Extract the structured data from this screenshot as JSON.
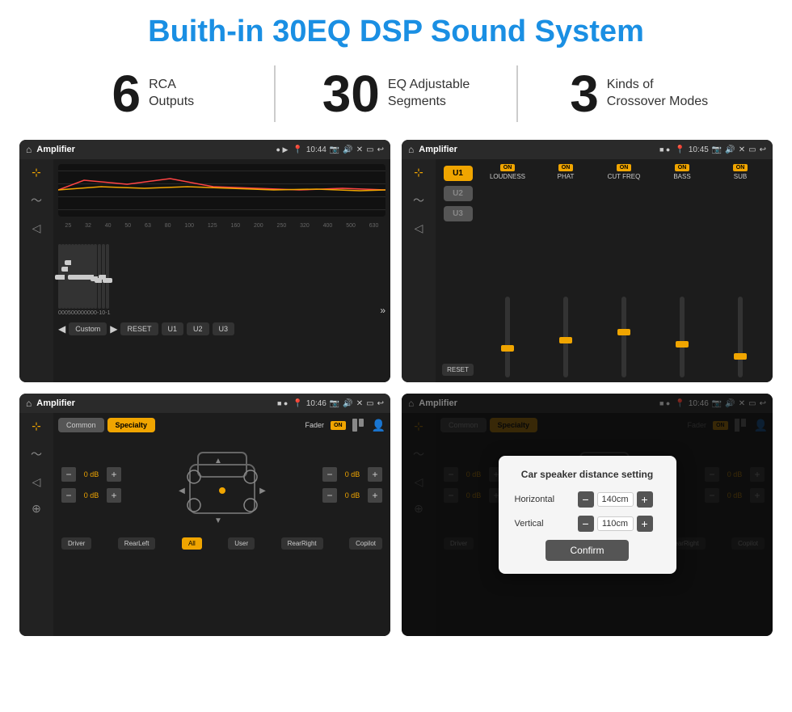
{
  "header": {
    "title": "Buith-in 30EQ DSP Sound System"
  },
  "stats": [
    {
      "number": "6",
      "label_line1": "RCA",
      "label_line2": "Outputs"
    },
    {
      "number": "30",
      "label_line1": "EQ Adjustable",
      "label_line2": "Segments"
    },
    {
      "number": "3",
      "label_line1": "Kinds of",
      "label_line2": "Crossover Modes"
    }
  ],
  "screens": {
    "eq": {
      "title": "Amplifier",
      "time": "10:44",
      "labels": [
        "25",
        "32",
        "40",
        "50",
        "63",
        "80",
        "100",
        "125",
        "160",
        "200",
        "250",
        "320",
        "400",
        "500",
        "630"
      ],
      "values": [
        "0",
        "0",
        "0",
        "5",
        "0",
        "0",
        "0",
        "0",
        "0",
        "0",
        "0",
        "0",
        "-1",
        "0",
        "-1"
      ],
      "preset": "Custom",
      "buttons": [
        "RESET",
        "U1",
        "U2",
        "U3"
      ]
    },
    "crossover": {
      "title": "Amplifier",
      "time": "10:45",
      "channels": [
        "LOUDNESS",
        "PHAT",
        "CUT FREQ",
        "BASS",
        "SUB"
      ],
      "u_buttons": [
        "U1",
        "U2",
        "U3"
      ]
    },
    "fader": {
      "title": "Amplifier",
      "time": "10:46",
      "tabs": [
        "Common",
        "Specialty"
      ],
      "fader_label": "Fader",
      "fader_on": "ON",
      "volumes": [
        "0 dB",
        "0 dB",
        "0 dB",
        "0 dB"
      ],
      "labels": [
        "Driver",
        "RearLeft",
        "All",
        "User",
        "RearRight",
        "Copilot"
      ]
    },
    "dialog": {
      "title": "Amplifier",
      "time": "10:46",
      "dialog_title": "Car speaker distance setting",
      "horizontal_label": "Horizontal",
      "horizontal_value": "140cm",
      "vertical_label": "Vertical",
      "vertical_value": "110cm",
      "confirm_label": "Confirm",
      "labels": [
        "Driver",
        "RearLeft",
        "All",
        "User",
        "RearRight",
        "Copilot"
      ]
    }
  },
  "icons": {
    "home": "⌂",
    "settings": "≡",
    "waveform": "∿",
    "speaker": "◁",
    "expand": "⊕",
    "next": "»",
    "prev": "«",
    "play": "▶",
    "pause": "◀",
    "search": "⊙",
    "person": "👤",
    "location": "📍",
    "camera": "📷",
    "sound": "🔊",
    "close": "✕",
    "minimize": "—",
    "back": "↩"
  }
}
